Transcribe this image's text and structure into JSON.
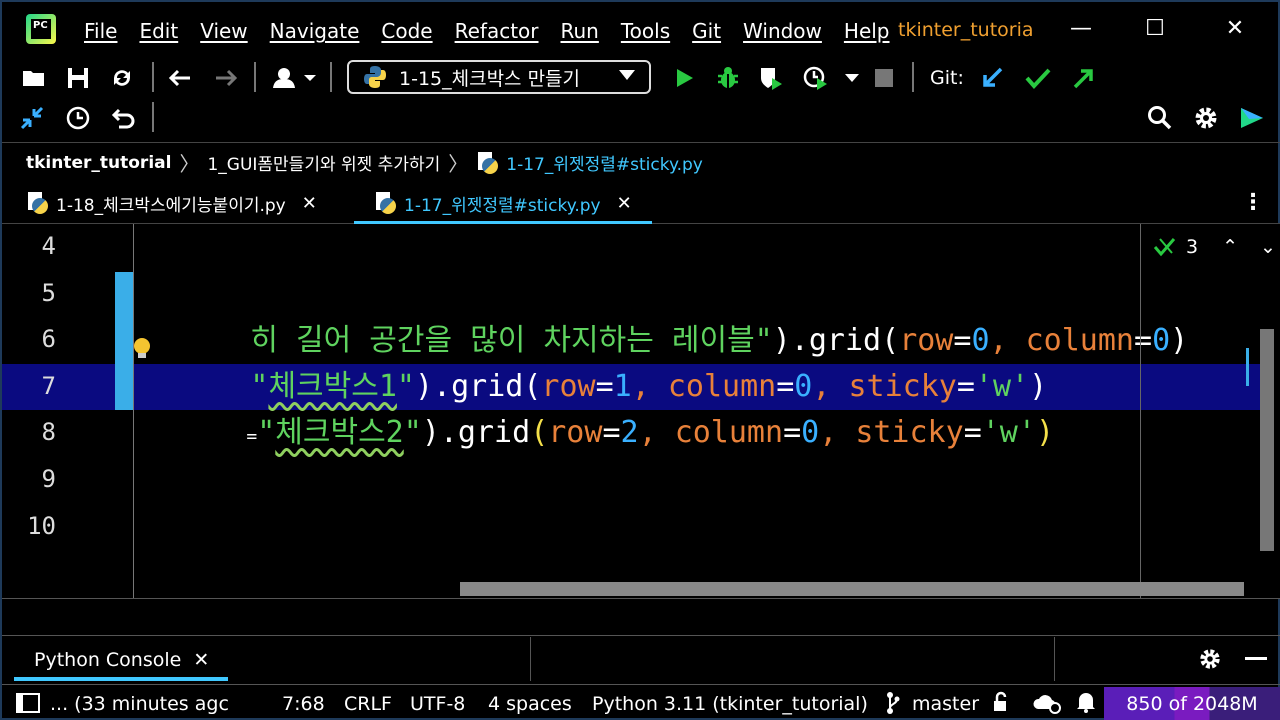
{
  "menu": {
    "logo": "PC",
    "items": [
      "File",
      "Edit",
      "View",
      "Navigate",
      "Code",
      "Refactor",
      "Run",
      "Tools",
      "Git",
      "Window",
      "Help"
    ],
    "project_title": "tkinter_tutoria"
  },
  "toolbar": {
    "run_config": "1-15_체크박스 만들기",
    "git_label": "Git:"
  },
  "breadcrumb": {
    "items": [
      "tkinter_tutorial",
      "1_GUI폼만들기와 위젯 추가하기",
      "1-17_위젯정렬#sticky.py"
    ]
  },
  "tabs": [
    {
      "label": "1-18_체크박스에기능붙이기.py",
      "active": false
    },
    {
      "label": "1-17_위젯정렬#sticky.py",
      "active": true
    }
  ],
  "editor": {
    "line_numbers": [
      "4",
      "5",
      "6",
      "7",
      "8",
      "9",
      "10"
    ],
    "inspection_count": "3",
    "line5": {
      "str": "히 길어 공간을 많이 차지하는 레이블\"",
      "p1": ").grid(",
      "k1": "row",
      "eq1": "=",
      "n1": "0",
      "c1": ", ",
      "k2": "column",
      "eq2": "=",
      "n2": "0",
      "p2": ")"
    },
    "line6": {
      "q": "\"",
      "str": "체크박스1",
      "q2": "\"",
      "p1": ").grid(",
      "k1": "row",
      "eq1": "=",
      "n1": "1",
      "c1": ", ",
      "k2": "column",
      "eq2": "=",
      "n2": "0",
      "c2": ", ",
      "k3": "sticky",
      "eq3": "=",
      "s3": "'w'",
      "p2": ")"
    },
    "line7": {
      "lead": "=",
      "q": "\"",
      "str": "체크박스2",
      "q2": "\"",
      "p1": ").grid",
      "p1b": "(",
      "k1": "row",
      "eq1": "=",
      "n1": "2",
      "c1": ", ",
      "k2": "column",
      "eq2": "=",
      "n2": "0",
      "c2": ", ",
      "k3": "sticky",
      "eq3": "=",
      "s3": "'w'",
      "p2": ")"
    }
  },
  "bottom_panel": {
    "tab_label": "Python Console"
  },
  "status": {
    "message": "... (33 minutes agc",
    "position": "7:68",
    "line_sep": "CRLF",
    "encoding": "UTF-8",
    "indent": "4 spaces",
    "interpreter": "Python 3.11 (tkinter_tutorial)",
    "branch": "master",
    "memory": "850 of 2048M"
  },
  "colors": {
    "accent": "#40c8ff",
    "project_title": "#f0a030",
    "string": "#5fd35f",
    "keyword_arg": "#e8813a",
    "number": "#3ab0ff",
    "current_line": "#0a0a80"
  }
}
